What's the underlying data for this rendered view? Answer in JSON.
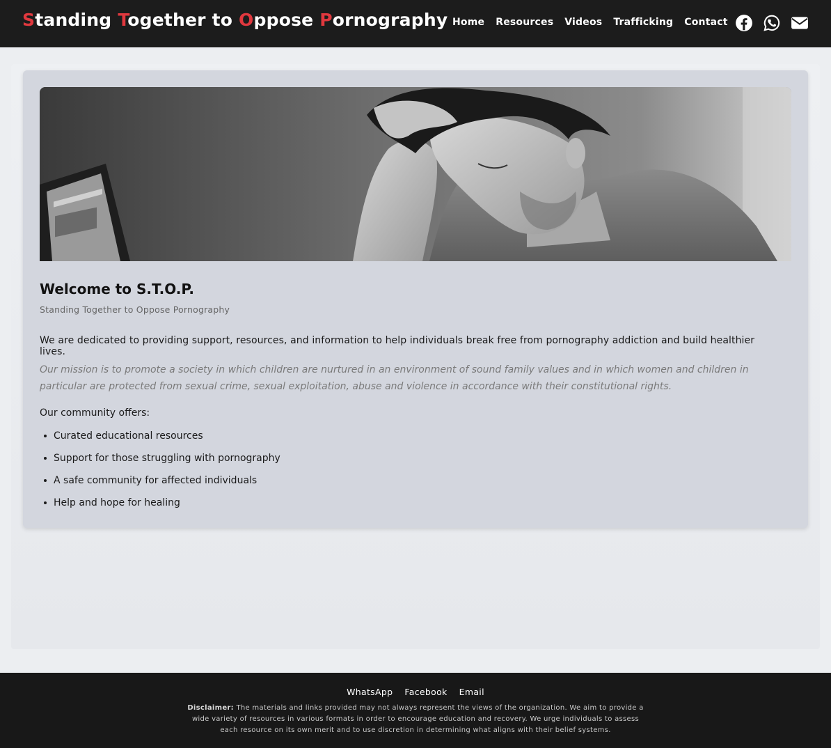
{
  "header": {
    "brand_words": [
      {
        "cap": "S",
        "rest": "tanding "
      },
      {
        "cap": "T",
        "rest": "ogether to "
      },
      {
        "cap": "O",
        "rest": "ppose "
      },
      {
        "cap": "P",
        "rest": "ornography"
      }
    ],
    "nav": [
      "Home",
      "Resources",
      "Videos",
      "Trafficking",
      "Contact"
    ],
    "social_icons": [
      "facebook-icon",
      "whatsapp-icon",
      "email-icon"
    ]
  },
  "main": {
    "hero_alt": "Young man resting his head on his hand in front of a laptop",
    "title": "Welcome to S.T.O.P.",
    "subtitle": "Standing Together to Oppose Pornography",
    "lead": "We are dedicated to providing support, resources, and information to help individuals break free from pornography addiction and build healthier lives.",
    "mission": "Our mission is to promote a society in which children are nurtured in an environment of sound family values and in which women and children in particular are protected from sexual crime, sexual exploitation, abuse and violence in accordance with their constitutional rights.",
    "offers_title": "Our community offers:",
    "offers": [
      "Curated educational resources",
      "Support for those struggling with pornography",
      "A safe community for affected individuals",
      "Help and hope for healing"
    ]
  },
  "footer": {
    "links": [
      "WhatsApp",
      "Facebook",
      "Email"
    ],
    "disclaimer_label": "Disclaimer:",
    "disclaimer_text": " The materials and links provided may not always represent the views of the organization. We aim to provide a wide variety of resources in various formats in order to encourage education and recovery. We urge individuals to assess each resource on its own merit and to use discretion in determining what aligns with their belief systems."
  },
  "colors": {
    "accent": "#e0383e",
    "header_bg": "#1c1c1c",
    "card_bg": "#d3d6de",
    "footer_bg": "#181818"
  }
}
